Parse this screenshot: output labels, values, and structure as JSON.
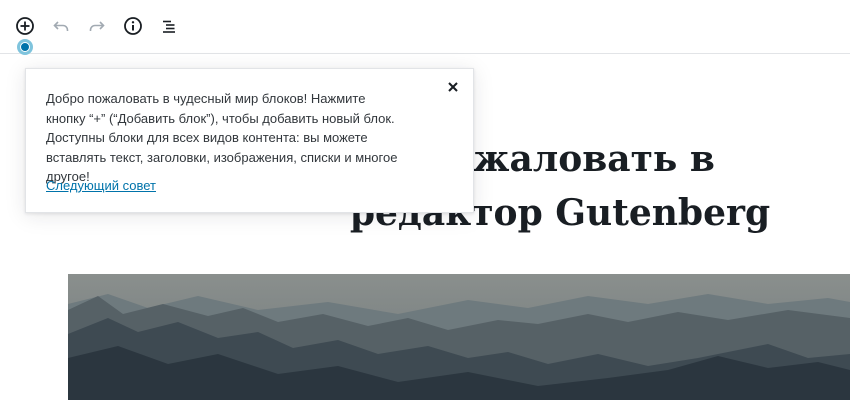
{
  "toolbar": {
    "buttons": [
      {
        "name": "add-block-button",
        "icon": "plus-circle-icon"
      },
      {
        "name": "undo-button",
        "icon": "undo-icon",
        "disabled": true
      },
      {
        "name": "redo-button",
        "icon": "redo-icon",
        "disabled": true
      },
      {
        "name": "info-button",
        "icon": "info-icon"
      },
      {
        "name": "block-navigation-button",
        "icon": "list-icon"
      }
    ]
  },
  "post": {
    "title_line1": "ожаловать в",
    "title_line2": "редактор Gutenberg"
  },
  "tip": {
    "text": "Добро пожаловать в чудесный мир блоков! Нажмите кнопку “+” (“Добавить блок”), чтобы добавить новый блок. Доступны блоки для всех видов контента: вы можете вставлять текст, заголовки, изображения, списки и многое другое!",
    "next_link": "Следующий совет"
  },
  "colors": {
    "accent": "#0073aa",
    "text": "#191e23",
    "tip_dot_halo": "#7fc4dd"
  }
}
